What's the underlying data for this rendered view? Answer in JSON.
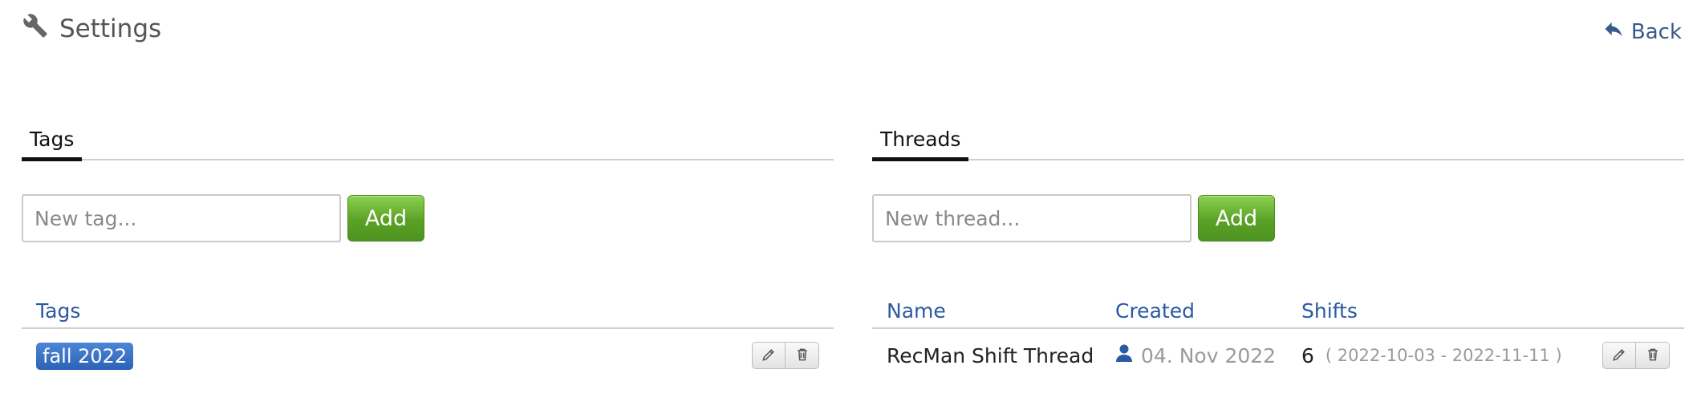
{
  "header": {
    "title": "Settings",
    "back_label": "Back"
  },
  "tags_panel": {
    "tab_label": "Tags",
    "input_placeholder": "New tag...",
    "add_label": "Add",
    "column_header": "Tags",
    "rows": [
      {
        "tag": "fall 2022"
      }
    ]
  },
  "threads_panel": {
    "tab_label": "Threads",
    "input_placeholder": "New thread...",
    "add_label": "Add",
    "columns": {
      "name": "Name",
      "created": "Created",
      "shifts": "Shifts"
    },
    "rows": [
      {
        "name": "RecMan Shift Thread",
        "created": "04. Nov 2022",
        "shifts_count": "6",
        "shifts_range": "( 2022-10-03 - 2022-11-11 )"
      }
    ]
  },
  "colors": {
    "accent_blue": "#2a5aa3",
    "add_green": "#5aa226",
    "tag_blue": "#2c62b7"
  },
  "icons": [
    "wrench-icon",
    "back-arrow-icon",
    "pencil-icon",
    "trash-icon",
    "user-icon"
  ]
}
